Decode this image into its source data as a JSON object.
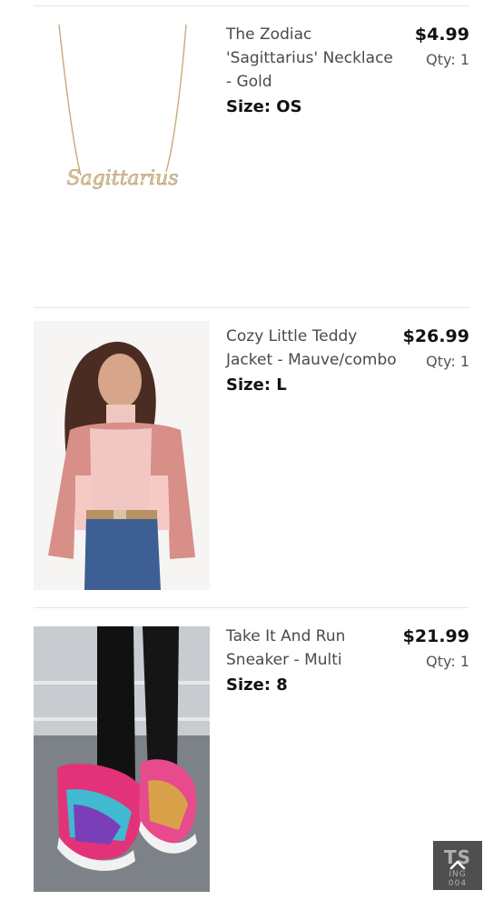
{
  "cart": {
    "items": [
      {
        "name": "The Zodiac 'Sagittarius' Necklace - Gold",
        "size_label": "Size: OS",
        "price": "$4.99",
        "qty": "Qty: 1",
        "image": "necklace-image"
      },
      {
        "name": "Cozy Little Teddy Jacket - Mauve/combo",
        "size_label": "Size: L",
        "price": "$26.99",
        "qty": "Qty: 1",
        "image": "jacket-model-image"
      },
      {
        "name": "Take It And Run Sneaker - Multi",
        "size_label": "Size: 8",
        "price": "$21.99",
        "qty": "Qty: 1",
        "image": "sneaker-image"
      }
    ]
  },
  "scroll_top": {
    "icon": "chevron-up-icon",
    "bg_text": "TS",
    "bg_small_1": "ING",
    "bg_small_2": "004"
  },
  "necklace_script_text": "Sagittarius"
}
